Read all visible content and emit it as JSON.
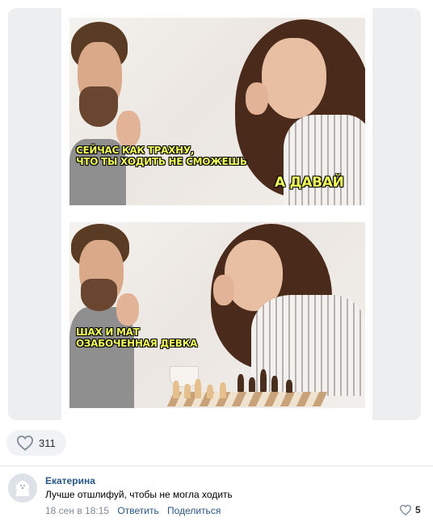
{
  "post": {
    "meme": {
      "top_caption_line1": "Сейчас как трахну,",
      "top_caption_line2": "что ты ходить не сможешь",
      "top_reply": "А давай",
      "bottom_caption_line1": "Шах и мат",
      "bottom_caption_line2": "озабоченная девка",
      "caption_color": "#f2ff58"
    },
    "likes": {
      "icon": "heart-outline-icon",
      "count": "311"
    }
  },
  "comment": {
    "avatar_icon": "default-dog-avatar-icon",
    "author": "Екатерина",
    "text": "Лучше отшлифуй, чтобы не могла ходить",
    "date": "18 сен в 18:15",
    "reply_label": "Ответить",
    "share_label": "Поделиться",
    "like_icon": "heart-outline-icon",
    "like_count": "5"
  },
  "colors": {
    "link": "#2a5885",
    "muted": "#818c99",
    "pill_bg": "#f0f2f5",
    "media_bg": "#edeef0"
  }
}
